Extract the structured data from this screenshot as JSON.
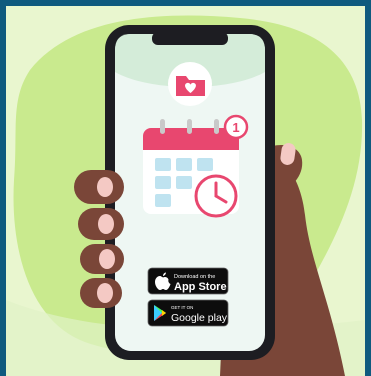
{
  "colors": {
    "frame": "#0f5a7e",
    "background": "#e9f6cf",
    "blob": "#c9ea8e",
    "phone_body": "#1d1d22",
    "screen": "#eef7f3",
    "screen_header": "#d4ecd9",
    "accent": "#e8476f",
    "calendar_cell": "#bfe3f0",
    "hand": "#7a4638",
    "nail": "#f4c9c4"
  },
  "icons": {
    "folder": "folder-heart-icon",
    "calendar": "calendar-icon",
    "clock": "clock-icon",
    "badge": "notification-badge",
    "apple": "apple-icon",
    "google_play": "google-play-icon"
  },
  "notification": {
    "count": "1"
  },
  "store_badges": {
    "app_store": {
      "small": "Download on the",
      "large": "App Store"
    },
    "google_play": {
      "small": "GET IT ON",
      "large": "Google play"
    }
  }
}
